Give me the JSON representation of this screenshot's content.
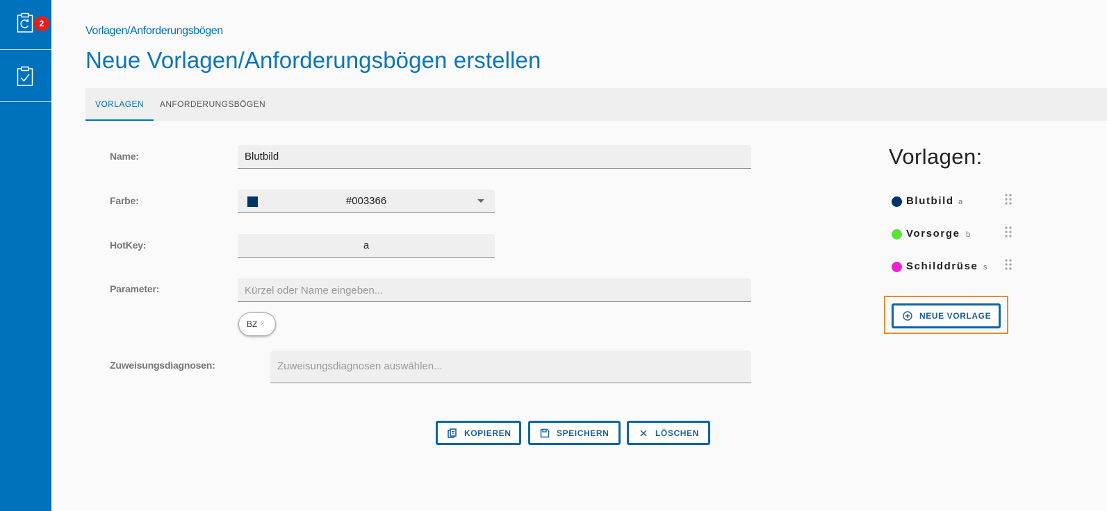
{
  "sidebar": {
    "items": [
      {
        "icon": "clipboard-refresh-icon",
        "badge": "2"
      },
      {
        "icon": "clipboard-check-icon"
      }
    ]
  },
  "header": {
    "breadcrumb": "Vorlagen/Anforderungsbögen",
    "title": "Neue Vorlagen/Anforderungsbögen erstellen"
  },
  "tabs": [
    {
      "label": "VORLAGEN",
      "active": true
    },
    {
      "label": "ANFORDERUNGSBÖGEN",
      "active": false
    }
  ],
  "form": {
    "name_label": "Name:",
    "name_value": "Blutbild",
    "color_label": "Farbe:",
    "color_value": "#003366",
    "hotkey_label": "HotKey:",
    "hotkey_value": "a",
    "parameter_label": "Parameter:",
    "parameter_placeholder": "Kürzel oder Name eingeben...",
    "parameter_chip": "BZ",
    "parameter_chip_remove": "x",
    "diagnosen_label": "Zuweisungsdiagnosen:",
    "diagnosen_placeholder": "Zuweisungsdiagnosen auswählen..."
  },
  "actions": {
    "copy": "KOPIEREN",
    "save": "SPEICHERN",
    "delete": "LÖSCHEN"
  },
  "vorlagen": {
    "title": "Vorlagen:",
    "items": [
      {
        "name": "Blutbild",
        "hotkey": "a",
        "color": "#003366"
      },
      {
        "name": "Vorsorge",
        "hotkey": "b",
        "color": "#5ee03a"
      },
      {
        "name": "Schilddrüse",
        "hotkey": "s",
        "color": "#ee22cc"
      }
    ],
    "new_label": "NEUE VORLAGE"
  }
}
